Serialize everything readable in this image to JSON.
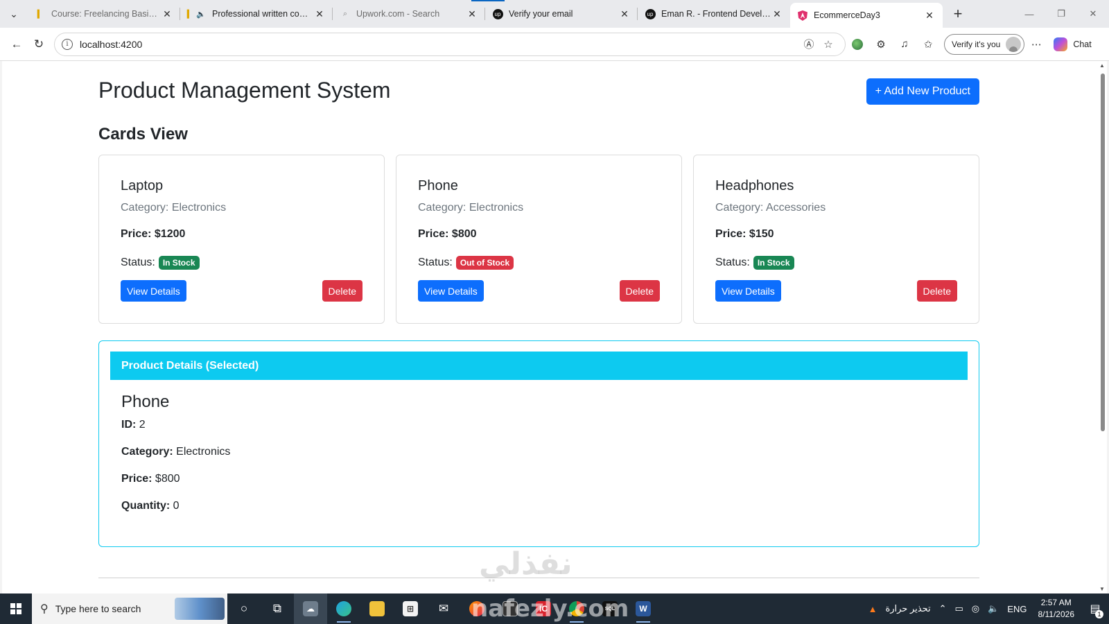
{
  "browser": {
    "tabs": [
      {
        "title": "Course: Freelancing Basics | Mai",
        "icon": "yellow-favicon",
        "dim": true
      },
      {
        "title": "Professional written comm",
        "icon": "speaker-icon",
        "dim": false
      },
      {
        "title": "Upwork.com - Search",
        "icon": "search-icon",
        "dim": true
      },
      {
        "title": "Verify your email",
        "icon": "upwork-icon",
        "dim": false
      },
      {
        "title": "Eman R. - Frontend Developer |",
        "icon": "upwork-icon",
        "dim": false
      },
      {
        "title": "EcommerceDay3",
        "icon": "angular-icon",
        "dim": false,
        "active": true
      }
    ],
    "url": "localhost:4200",
    "verify_label": "Verify it's you",
    "chat_label": "Chat"
  },
  "page": {
    "title": "Product Management System",
    "add_button": "+ Add New Product",
    "section_title": "Cards View",
    "category_prefix": "Category:",
    "price_prefix": "Price:",
    "status_prefix": "Status:",
    "view_label": "View Details",
    "delete_label": "Delete",
    "products": [
      {
        "name": "Laptop",
        "category": "Electronics",
        "price": "$1200",
        "status": "In Stock",
        "in_stock": true
      },
      {
        "name": "Phone",
        "category": "Electronics",
        "price": "$800",
        "status": "Out of Stock",
        "in_stock": false
      },
      {
        "name": "Headphones",
        "category": "Accessories",
        "price": "$150",
        "status": "In Stock",
        "in_stock": true
      }
    ],
    "details": {
      "header": "Product Details (Selected)",
      "name": "Phone",
      "id_label": "ID:",
      "id": "2",
      "category_label": "Category:",
      "category": "Electronics",
      "price_label": "Price:",
      "price": "$800",
      "quantity_label": "Quantity:",
      "quantity": "0"
    },
    "watermark": "نفذلي"
  },
  "taskbar": {
    "search_placeholder": "Type here to search",
    "weather_text": "تحذير حرارة",
    "lang": "ENG",
    "time": "2:57 AM",
    "date": "8/11/2026",
    "notif_count": "1",
    "watermark_text": "nafezly.com"
  },
  "colors": {
    "primary": "#0d6efd",
    "danger": "#dc3545",
    "success": "#198754",
    "info": "#0dcaf0"
  }
}
